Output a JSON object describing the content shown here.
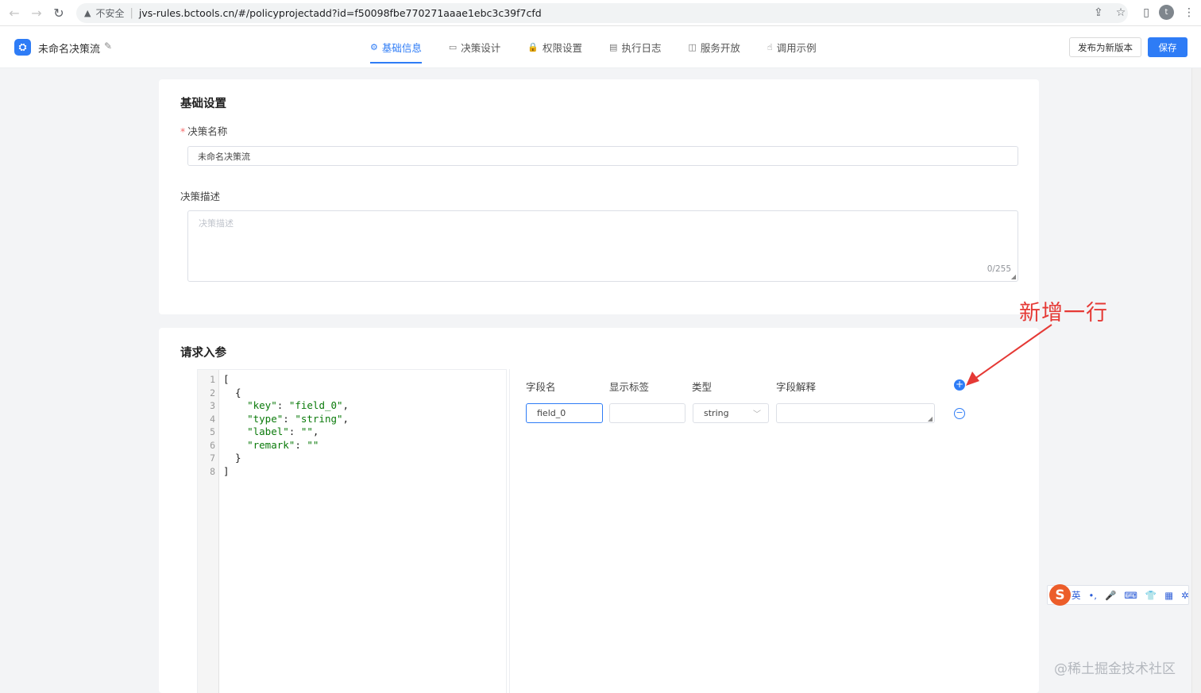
{
  "browser": {
    "back": "←",
    "forward": "→",
    "reload": "↻",
    "warning_icon": "▲",
    "insecure_label": "不安全",
    "url": "jvs-rules.bctools.cn/#/policyprojectadd?id=f50098fbe770271aaae1ebc3c39f7cfd",
    "share_icon": "⇪",
    "star_icon": "☆",
    "panel_icon": "▯",
    "profile_initial": "t",
    "menu_icon": "⋮"
  },
  "header": {
    "logo_glyph": "⛭",
    "app_title": "未命名决策流",
    "edit_glyph": "✎",
    "tabs": [
      {
        "icon": "⚙",
        "label": "基础信息",
        "active": true
      },
      {
        "icon": "▭",
        "label": "决策设计",
        "active": false
      },
      {
        "icon": "🔒",
        "label": "权限设置",
        "active": false
      },
      {
        "icon": "▤",
        "label": "执行日志",
        "active": false
      },
      {
        "icon": "◫",
        "label": "服务开放",
        "active": false
      },
      {
        "icon": "☝",
        "label": "调用示例",
        "active": false
      }
    ],
    "publish_label": "发布为新版本",
    "save_label": "保存"
  },
  "basic": {
    "title": "基础设置",
    "required_mark": "*",
    "name_label": "决策名称",
    "name_value": "未命名决策流",
    "desc_label": "决策描述",
    "desc_placeholder": "决策描述",
    "desc_count": "0/255"
  },
  "params": {
    "title": "请求入参",
    "line_numbers": [
      "1",
      "2",
      "3",
      "4",
      "5",
      "6",
      "7",
      "8"
    ],
    "code": {
      "l1": "[",
      "l2": "  {",
      "l3_key": "\"key\"",
      "l3_val": "\"field_0\"",
      "l4_key": "\"type\"",
      "l4_val": "\"string\"",
      "l5_key": "\"label\"",
      "l5_val": "\"\"",
      "l6_key": "\"remark\"",
      "l6_val": "\"\"",
      "l7": "  }",
      "l8": "]",
      "colon": ": ",
      "comma": ","
    },
    "columns": [
      "字段名",
      "显示标签",
      "类型",
      "字段解释"
    ],
    "add_glyph": "+",
    "remove_glyph": "−",
    "row": {
      "field_name": "field_0",
      "display_label": "",
      "type": "string",
      "remark": ""
    },
    "chevron": "﹀"
  },
  "annotation": {
    "text": "新增一行",
    "color": "#e53935"
  },
  "ime": {
    "logo": "S",
    "items": [
      "英",
      "•,",
      "🎤",
      "⌨",
      "👕",
      "▦",
      "✲"
    ]
  },
  "watermark": "@稀土掘金技术社区",
  "colors": {
    "accent": "#2e7cf6",
    "annotation": "#e53935"
  }
}
